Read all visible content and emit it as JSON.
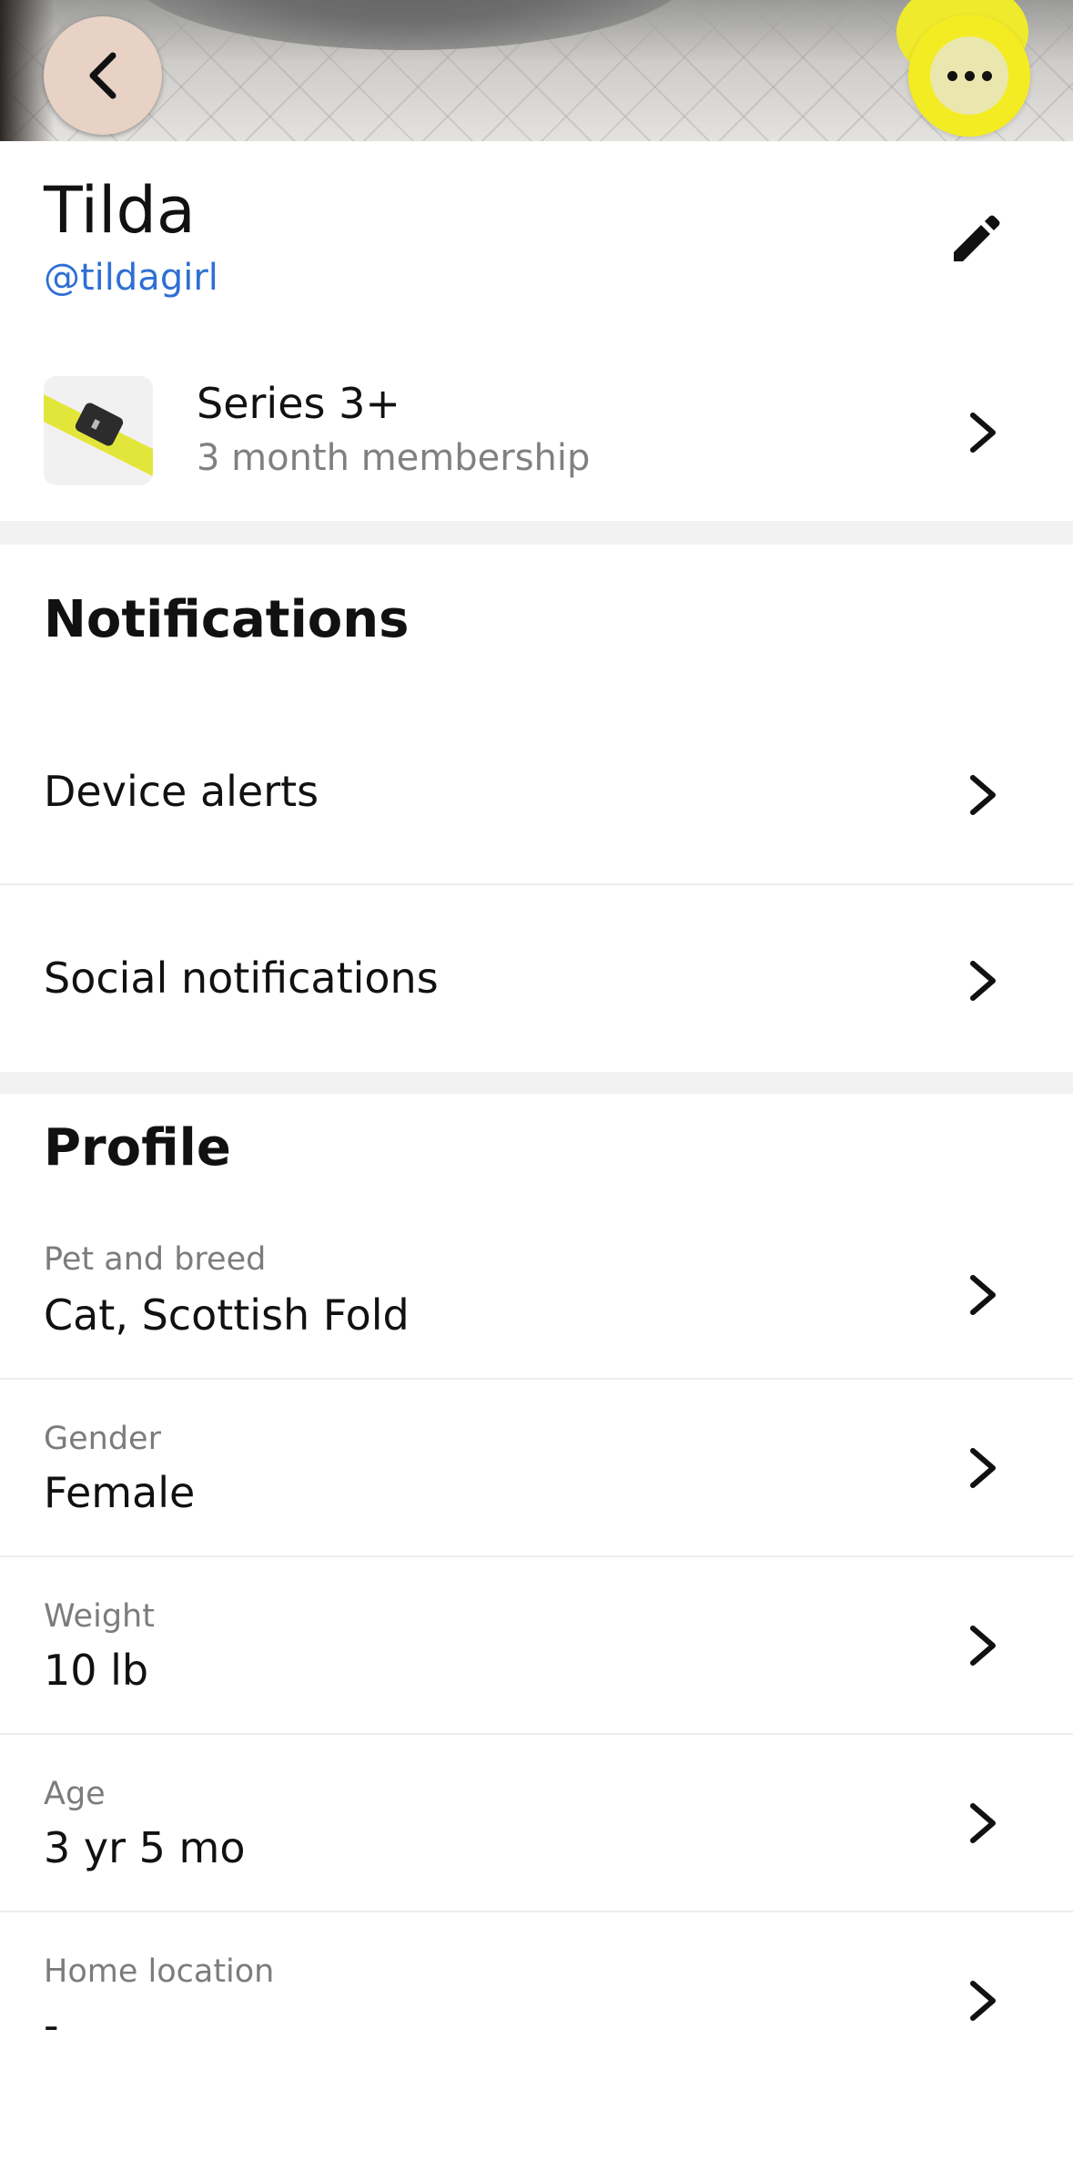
{
  "header": {
    "back_icon": "chevron-left-icon",
    "more_icon": "more-horizontal-icon"
  },
  "pet": {
    "name": "Tilda",
    "handle": "@tildagirl",
    "edit_icon": "pencil-icon"
  },
  "device": {
    "title": "Series 3+",
    "subtitle": "3 month membership",
    "accent": "#e3e63a"
  },
  "notifications": {
    "title": "Notifications",
    "items": [
      {
        "label": "Device alerts"
      },
      {
        "label": "Social notifications"
      }
    ]
  },
  "profile": {
    "title": "Profile",
    "fields": [
      {
        "label": "Pet and breed",
        "value": "Cat, Scottish Fold"
      },
      {
        "label": "Gender",
        "value": "Female"
      },
      {
        "label": "Weight",
        "value": "10 lb"
      },
      {
        "label": "Age",
        "value": "3 yr 5 mo"
      },
      {
        "label": "Home location",
        "value": "-"
      }
    ]
  },
  "colors": {
    "link": "#2f6fd4",
    "badge_yellow": "#f4ec22",
    "back_button": "#e7d2c5"
  }
}
